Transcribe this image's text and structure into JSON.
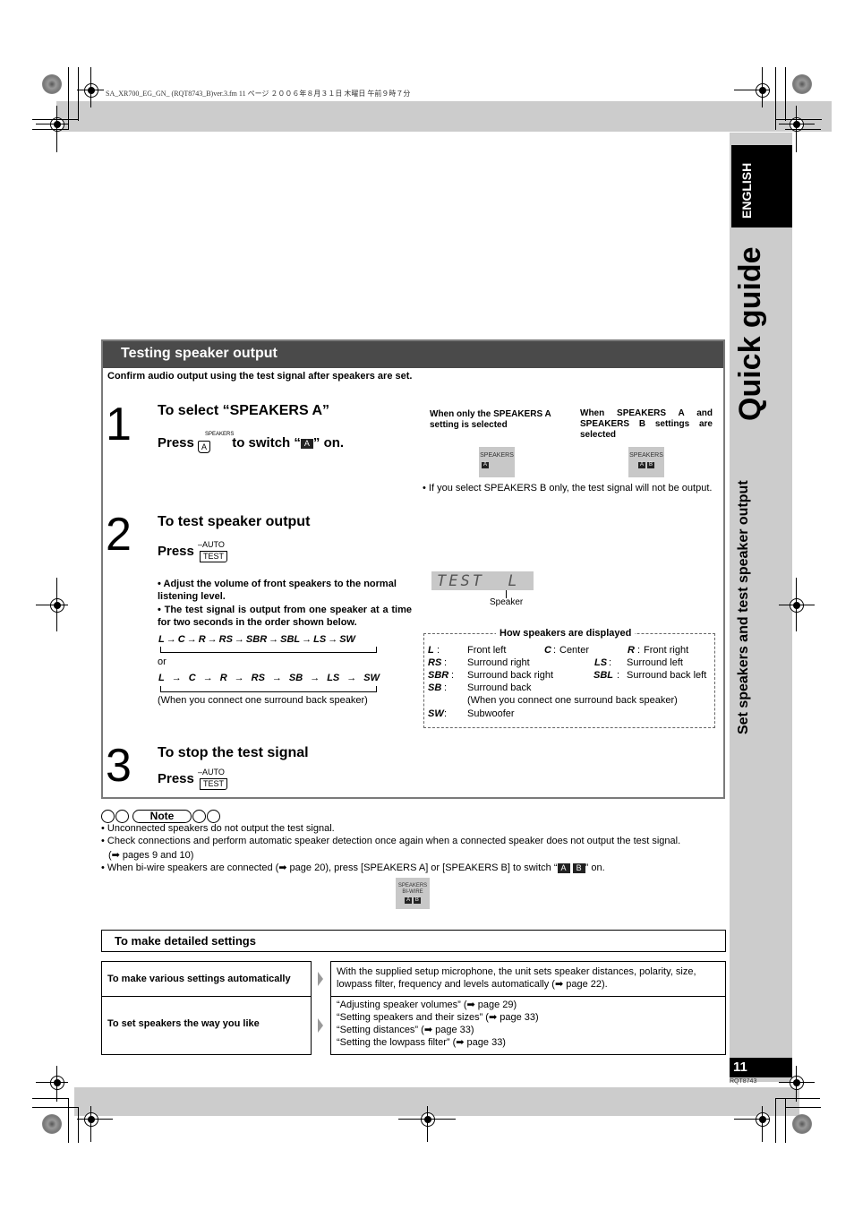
{
  "print_header": "SA_XR700_EG_GN_ (RQT8743_B)ver.3.fm  11 ページ  ２００６年８月３１日  木曜日  午前９時７分",
  "side_tab": {
    "language": "ENGLISH",
    "section": "Quick guide",
    "subsection": "Set speakers and test speaker output"
  },
  "main": {
    "heading": "Testing speaker output",
    "intro": "Confirm audio output using the test signal after speakers are set.",
    "steps": [
      {
        "number": "1",
        "title": "To select “SPEAKERS A”",
        "press": "Press",
        "button_top": "SPEAKERS",
        "button_label": "A",
        "after": "to switch “",
        "indicator": "A",
        "after2": "” on."
      },
      {
        "number": "2",
        "title": "To test speaker output",
        "press": "Press",
        "button_top": "–AUTO",
        "button_label": "TEST",
        "bullets": [
          "Adjust the volume of front speakers to the normal listening level.",
          "The test signal is output from one speaker at a time for two seconds in the order shown below."
        ],
        "sequence1": [
          "L",
          "C",
          "R",
          "RS",
          "SBR",
          "SBL",
          "LS",
          "SW"
        ],
        "or": "or",
        "sequence2": [
          "L",
          "C",
          "R",
          "RS",
          "SB",
          "LS",
          "SW"
        ],
        "sequence2_note": "(When you connect one surround back speaker)"
      },
      {
        "number": "3",
        "title": "To stop the test signal",
        "press": "Press",
        "button_top": "–AUTO",
        "button_label": "TEST"
      }
    ],
    "display_examples": {
      "only_a_caption": "When only the SPEAKERS A setting is selected",
      "a_and_b_caption": "When SPEAKERS A and SPEAKERS B settings are selected",
      "lcd_label": "SPEAKERS",
      "ind_a": "A",
      "ind_b": "B",
      "note": "If you select SPEAKERS B only, the test signal will not be output."
    },
    "lcd_test": {
      "text": "TEST  L",
      "pointer_label": "Speaker"
    },
    "legend": {
      "title": "How speakers are displayed",
      "rows": [
        {
          "abbr": "L",
          "desc": "Front left",
          "abbr2": "C",
          "desc2": "Center",
          "abbr3": "R",
          "desc3": "Front right"
        },
        {
          "abbr": "RS",
          "desc": "Surround right",
          "abbr2": "LS",
          "desc2": "Surround left"
        },
        {
          "abbr": "SBR",
          "desc": "Surround back right",
          "abbr2": "SBL",
          "desc2": "Surround back left"
        },
        {
          "abbr": "SB",
          "desc": "Surround back",
          "desc_extra": "(When you connect one surround back speaker)"
        },
        {
          "abbr": "SW",
          "desc": "Subwoofer"
        }
      ]
    }
  },
  "note": {
    "label": "Note",
    "items": [
      "Unconnected speakers do not output the test signal.",
      "Check connections and perform automatic speaker detection once again when a connected speaker does not output the test signal.",
      "(➡ pages 9 and 10)",
      "When bi-wire speakers are connected (➡ page 20), press [SPEAKERS A] or [SPEAKERS B] to switch “",
      "” on."
    ],
    "biwire_lcd": {
      "line1": "SPEAKERS",
      "line2": "BI-WIRE",
      "a": "A",
      "b": "B"
    }
  },
  "detailed": {
    "heading": "To make detailed settings",
    "rows": [
      {
        "label": "To make various settings automatically",
        "text": [
          "With the supplied setup microphone, the unit sets speaker distances, polarity, size,",
          "lowpass filter, frequency and levels automatically (➡ page 22)."
        ]
      },
      {
        "label": "To set speakers the way you like",
        "text": [
          "“Adjusting speaker volumes” (➡ page 29)",
          "“Setting speakers and their sizes” (➡ page 33)",
          "“Setting distances” (➡ page 33)",
          "“Setting the lowpass filter” (➡ page 33)"
        ]
      }
    ]
  },
  "footer": {
    "page_number": "11",
    "doc_code": "RQT8743"
  }
}
